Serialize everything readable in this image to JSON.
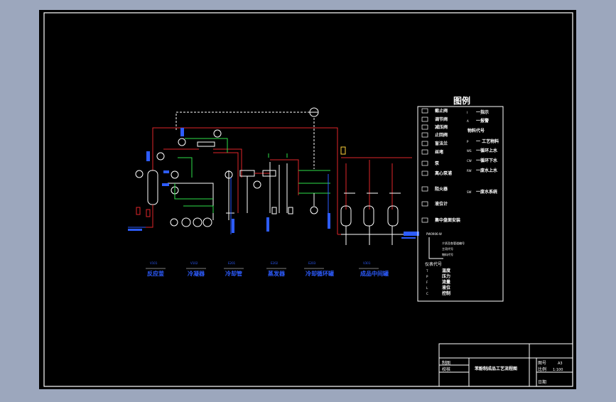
{
  "colors": {
    "viewport_bg": "#9ca7bd",
    "sheet_bg": "#000000",
    "border": "#ffffff",
    "process_line": "#e0262a",
    "utility_line": "#2ee04a",
    "label_blue": "#2d5cff",
    "symbol_white": "#ffffff"
  },
  "legend": {
    "title": "图例",
    "left_items": [
      {
        "symbol": "globe-valve-icon",
        "label": "截止阀"
      },
      {
        "symbol": "control-valve-icon",
        "label": "调节阀"
      },
      {
        "symbol": "safety-valve-icon",
        "label": "减压阀"
      },
      {
        "symbol": "check-valve-icon",
        "label": "止回阀"
      },
      {
        "symbol": "flange-icon",
        "label": "盲法兰"
      },
      {
        "symbol": "plug-icon",
        "label": "丝堵"
      },
      {
        "symbol": "pump-icon",
        "label": "泵"
      },
      {
        "symbol": "centrifugal-pump-icon",
        "label": "离心泵浦"
      },
      {
        "symbol": "filter-icon",
        "label": "阻火器"
      },
      {
        "symbol": "tank-icon",
        "label": "液位计"
      },
      {
        "symbol": "instrument-icon",
        "label": "集中盘面安装"
      }
    ],
    "right_items": [
      {
        "code": "I",
        "label": "一指示"
      },
      {
        "code": "A",
        "label": "一报警"
      },
      {
        "code": "",
        "label": "物料代号"
      },
      {
        "code": "P",
        "label": "一 工艺物料"
      },
      {
        "code": "WS",
        "label": "一循环上水"
      },
      {
        "code": "CW",
        "label": "一循环下水"
      },
      {
        "code": "RW",
        "label": "一废水上水"
      },
      {
        "code": "SW",
        "label": "一废水系统"
      }
    ],
    "pipe_code": "PW0906-W",
    "pipe_code_notes": [
      "介质及各管道编号",
      "主项代号",
      "物料代号"
    ],
    "instrument_title": "仪表代号",
    "instrument_items": [
      {
        "code": "T",
        "label": "温度"
      },
      {
        "code": "P",
        "label": "压力"
      },
      {
        "code": "F",
        "label": "流量"
      },
      {
        "code": "L",
        "label": "液位"
      },
      {
        "code": "C",
        "label": "控制"
      }
    ]
  },
  "stations": [
    {
      "code": "V101",
      "name": "反应釜"
    },
    {
      "code": "V102",
      "name": "冷凝器"
    },
    {
      "code": "E201",
      "name": "冷却管"
    },
    {
      "code": "E202",
      "name": "蒸发器"
    },
    {
      "code": "E203",
      "name": "冷却循环罐"
    },
    {
      "code": "V301",
      "name": "成品中间罐"
    }
  ],
  "title_block": {
    "drawing_title": "苯酚制成品工艺流程图",
    "role_1": "制图",
    "role_2": "校核",
    "label_drawing_no": "图号",
    "drawing_no": "A3",
    "label_scale": "比例",
    "scale": "1:100",
    "label_date": "日期"
  }
}
